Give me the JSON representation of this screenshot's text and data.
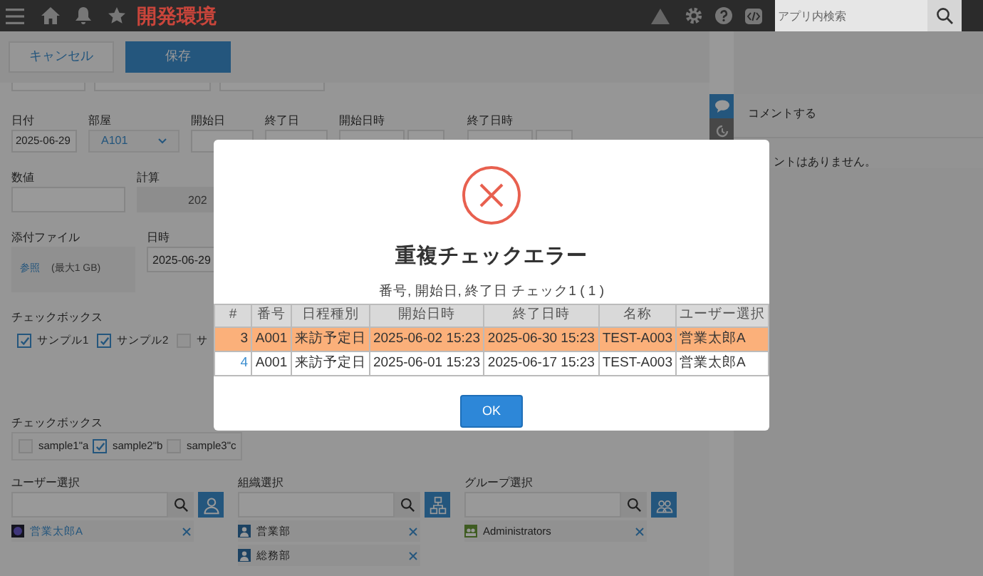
{
  "header": {
    "title": "開発環境",
    "search": {
      "placeholder": "アプリ内検索"
    }
  },
  "toolbar": {
    "buttons": [
      {
        "label": "キャンセル",
        "kind": "secondary"
      },
      {
        "label": "保存",
        "kind": "primary"
      }
    ]
  },
  "date_row": [
    {
      "label": "日付",
      "kind": "text",
      "value": "2025-06-29"
    },
    {
      "label": "部屋",
      "kind": "select",
      "value": "A101"
    },
    {
      "label": "開始日",
      "kind": "text"
    },
    {
      "label": "終了日",
      "kind": "text"
    },
    {
      "label": "開始日時",
      "kind": "datetime"
    },
    {
      "label": "終了日時",
      "kind": "datetime"
    }
  ],
  "number_field": {
    "label": "数値"
  },
  "calc_field": {
    "label": "計算",
    "value": "202"
  },
  "attachment": {
    "label": "添付ファイル",
    "link": "参照",
    "note": "(最大1 GB)"
  },
  "datetime_field": {
    "label": "日時",
    "value": "2025-06-29"
  },
  "checkbox_group_1": {
    "label": "チェックボックス",
    "options": [
      {
        "label": "サンプル1",
        "checked": true
      },
      {
        "label": "サンプル2",
        "checked": true
      },
      {
        "label": "サ",
        "checked": false
      }
    ]
  },
  "checkbox_group_2": {
    "label": "チェックボックス",
    "options": [
      {
        "label": "sample1\"a",
        "checked": false
      },
      {
        "label": "sample2\"b",
        "checked": true
      },
      {
        "label": "sample3\"c",
        "checked": false
      }
    ]
  },
  "pickers": [
    {
      "label": "ユーザー選択",
      "kind": "user",
      "entries": [
        "営業太郎A"
      ]
    },
    {
      "label": "組織選択",
      "kind": "org",
      "entries": [
        "営業部",
        "総務部"
      ]
    },
    {
      "label": "グループ選択",
      "kind": "group",
      "entries": [
        "Administrators"
      ]
    }
  ],
  "comments": {
    "action": "コメントする",
    "empty": "ントはありません。"
  },
  "dialog": {
    "title": "重複チェックエラー",
    "subtitle": "番号, 開始日, 終了日 チェック1 ( 1 )",
    "columns": [
      "#",
      "番号",
      "日程種別",
      "開始日時",
      "終了日時",
      "名称",
      "ユーザー選択"
    ],
    "rows": [
      {
        "selected": true,
        "cells": [
          "3",
          "A001",
          "来訪予定日",
          "2025-06-02 15:23",
          "2025-06-30 15:23",
          "TEST-A003",
          "営業太郎A"
        ]
      },
      {
        "selected": false,
        "cells": [
          "4",
          "A001",
          "来訪予定日",
          "2025-06-01 15:23",
          "2025-06-17 15:23",
          "TEST-A003",
          "営業太郎A"
        ]
      }
    ],
    "button": "OK"
  }
}
